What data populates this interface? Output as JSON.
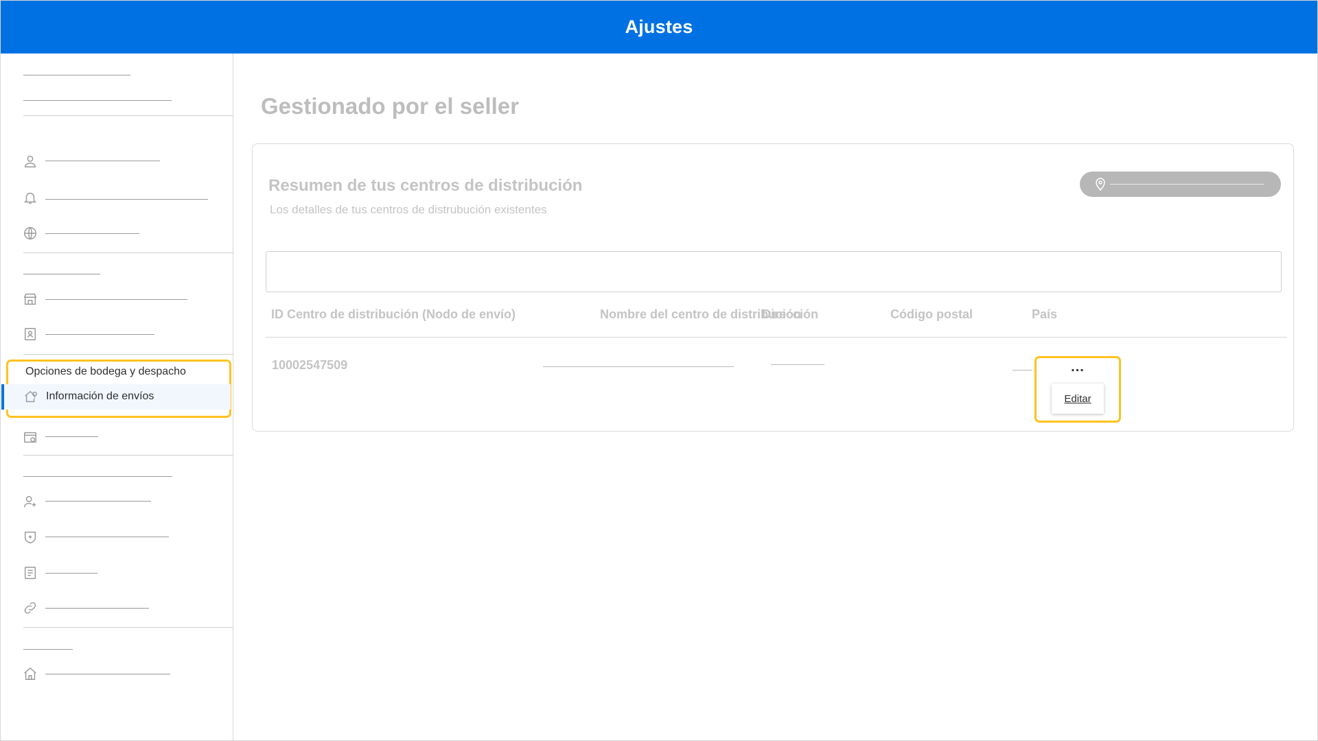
{
  "header": {
    "title": "Ajustes"
  },
  "sidebar": {
    "section_label": "Opciones de bodega y despacho",
    "active_item": "Información de envíos",
    "icons": [
      "user-icon",
      "bell-icon",
      "globe-icon",
      "store-icon",
      "id-card-icon",
      "shipping-house-icon",
      "payment-card-icon",
      "add-user-icon",
      "badge-icon",
      "document-icon",
      "link-icon",
      "home-icon"
    ]
  },
  "main": {
    "page_title": "Gestionado por el seller",
    "card": {
      "title": "Resumen de tus centros de distribución",
      "subtitle": "Los detalles de tus centros de distrubución existentes",
      "location_icon": "map-pin-icon",
      "table": {
        "columns": [
          "ID Centro de distribución (Nodo de envío)",
          "Nombre del centro de distribución",
          "Dirección",
          "Código postal",
          "País"
        ],
        "rows": [
          {
            "id": "10002547509"
          }
        ]
      },
      "actions": {
        "more": "...",
        "edit": "Editar"
      }
    }
  }
}
